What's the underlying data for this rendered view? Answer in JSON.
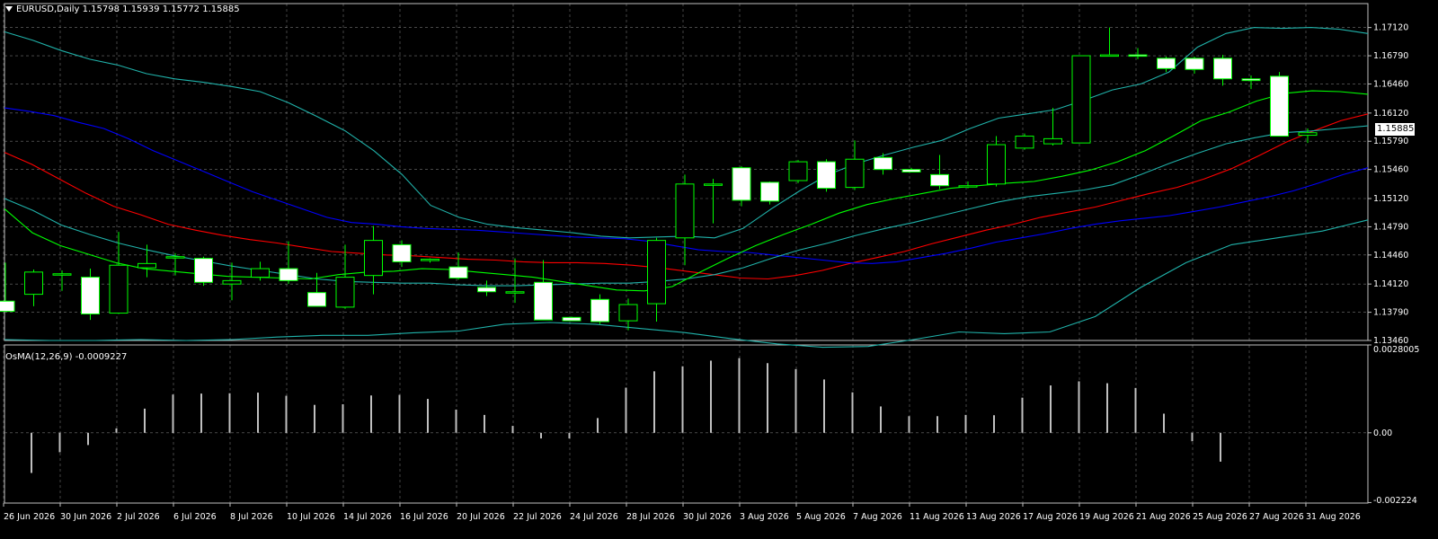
{
  "header": {
    "symbol_tf": "EURUSD,Daily",
    "ohlc": "1.15798 1.15939 1.15772 1.15885"
  },
  "osma_header": {
    "label": "OsMA(12,26,9) -0.0009227"
  },
  "current_price_label": "1.15885",
  "colors": {
    "background": "#000000",
    "grid": "#c0c0c0",
    "candle_body_up": "#000000",
    "candle_body_down": "#ffffff",
    "candle_outline": "#00ff00",
    "ma_red": "#ff0000",
    "ma_blue": "#0000ff",
    "bands": "#20b2aa",
    "ma_green": "#00ff00",
    "osma": "#c0c0c0"
  },
  "chart_data": [
    {
      "type": "candlestick",
      "title": "EURUSD,Daily",
      "ylim": [
        1.1346,
        1.174
      ],
      "y_ticks": [
        "1.17120",
        "1.16790",
        "1.16460",
        "1.16120",
        "1.15790",
        "1.15460",
        "1.15120",
        "1.14790",
        "1.14460",
        "1.14120",
        "1.13790",
        "1.13460"
      ],
      "x_labels": [
        "26 Jun 2026",
        "30 Jun 2026",
        "2 Jul 2026",
        "6 Jul 2026",
        "8 Jul 2026",
        "10 Jul 2026",
        "14 Jul 2026",
        "16 Jul 2026",
        "20 Jul 2026",
        "22 Jul 2026",
        "24 Jul 2026",
        "28 Jul 2026",
        "30 Jul 2026",
        "3 Aug 2026",
        "5 Aug 2026",
        "7 Aug 2026",
        "11 Aug 2026",
        "13 Aug 2026",
        "17 Aug 2026",
        "19 Aug 2026",
        "21 Aug 2026",
        "25 Aug 2026",
        "27 Aug 2026",
        "31 Aug 2026"
      ],
      "candles": [
        {
          "o": 1.1392,
          "h": 1.1437,
          "l": 1.138,
          "c": 1.138
        },
        {
          "o": 1.14,
          "h": 1.1429,
          "l": 1.1386,
          "c": 1.1426
        },
        {
          "o": 1.1424,
          "h": 1.1428,
          "l": 1.1404,
          "c": 1.1424
        },
        {
          "o": 1.142,
          "h": 1.143,
          "l": 1.137,
          "c": 1.1377
        },
        {
          "o": 1.1378,
          "h": 1.1473,
          "l": 1.1377,
          "c": 1.1434
        },
        {
          "o": 1.1431,
          "h": 1.1458,
          "l": 1.142,
          "c": 1.1436
        },
        {
          "o": 1.1444,
          "h": 1.1448,
          "l": 1.1422,
          "c": 1.1444
        },
        {
          "o": 1.1442,
          "h": 1.1444,
          "l": 1.141,
          "c": 1.1414
        },
        {
          "o": 1.1412,
          "h": 1.1437,
          "l": 1.1393,
          "c": 1.1416
        },
        {
          "o": 1.142,
          "h": 1.1438,
          "l": 1.1416,
          "c": 1.143
        },
        {
          "o": 1.143,
          "h": 1.1462,
          "l": 1.1412,
          "c": 1.1416
        },
        {
          "o": 1.1402,
          "h": 1.1425,
          "l": 1.139,
          "c": 1.1386
        },
        {
          "o": 1.1385,
          "h": 1.1458,
          "l": 1.1383,
          "c": 1.142
        },
        {
          "o": 1.1422,
          "h": 1.148,
          "l": 1.14,
          "c": 1.1463
        },
        {
          "o": 1.1458,
          "h": 1.1463,
          "l": 1.1432,
          "c": 1.1438
        },
        {
          "o": 1.1441,
          "h": 1.1442,
          "l": 1.1437,
          "c": 1.1441
        },
        {
          "o": 1.1432,
          "h": 1.1449,
          "l": 1.1417,
          "c": 1.1419
        },
        {
          "o": 1.1408,
          "h": 1.1416,
          "l": 1.1398,
          "c": 1.1403
        },
        {
          "o": 1.1403,
          "h": 1.1442,
          "l": 1.139,
          "c": 1.1403
        },
        {
          "o": 1.1414,
          "h": 1.144,
          "l": 1.137,
          "c": 1.137
        },
        {
          "o": 1.1373,
          "h": 1.1374,
          "l": 1.137,
          "c": 1.1369
        },
        {
          "o": 1.1394,
          "h": 1.14,
          "l": 1.1365,
          "c": 1.1368
        },
        {
          "o": 1.1369,
          "h": 1.1395,
          "l": 1.1358,
          "c": 1.1388
        },
        {
          "o": 1.1389,
          "h": 1.1466,
          "l": 1.1368,
          "c": 1.1463
        },
        {
          "o": 1.1466,
          "h": 1.154,
          "l": 1.1434,
          "c": 1.1529
        },
        {
          "o": 1.1528,
          "h": 1.1535,
          "l": 1.1483,
          "c": 1.1529
        },
        {
          "o": 1.1548,
          "h": 1.155,
          "l": 1.1503,
          "c": 1.151
        },
        {
          "o": 1.1531,
          "h": 1.1532,
          "l": 1.1505,
          "c": 1.1509
        },
        {
          "o": 1.1533,
          "h": 1.1557,
          "l": 1.153,
          "c": 1.1555
        },
        {
          "o": 1.1555,
          "h": 1.1558,
          "l": 1.152,
          "c": 1.1524
        },
        {
          "o": 1.1525,
          "h": 1.158,
          "l": 1.1522,
          "c": 1.1558
        },
        {
          "o": 1.156,
          "h": 1.1565,
          "l": 1.154,
          "c": 1.1546
        },
        {
          "o": 1.1546,
          "h": 1.1548,
          "l": 1.1543,
          "c": 1.1543
        },
        {
          "o": 1.154,
          "h": 1.1563,
          "l": 1.1523,
          "c": 1.1527
        },
        {
          "o": 1.1526,
          "h": 1.1532,
          "l": 1.1524,
          "c": 1.1527
        },
        {
          "o": 1.1529,
          "h": 1.1585,
          "l": 1.1526,
          "c": 1.1575
        },
        {
          "o": 1.1571,
          "h": 1.1588,
          "l": 1.1569,
          "c": 1.1585
        },
        {
          "o": 1.1576,
          "h": 1.1618,
          "l": 1.1574,
          "c": 1.1582
        },
        {
          "o": 1.1577,
          "h": 1.1679,
          "l": 1.1577,
          "c": 1.1679
        },
        {
          "o": 1.168,
          "h": 1.1712,
          "l": 1.1678,
          "c": 1.168
        },
        {
          "o": 1.168,
          "h": 1.1688,
          "l": 1.1675,
          "c": 1.1679
        },
        {
          "o": 1.1676,
          "h": 1.1678,
          "l": 1.166,
          "c": 1.1664
        },
        {
          "o": 1.1676,
          "h": 1.1678,
          "l": 1.1658,
          "c": 1.1663
        },
        {
          "o": 1.1676,
          "h": 1.168,
          "l": 1.1644,
          "c": 1.1652
        },
        {
          "o": 1.1652,
          "h": 1.1656,
          "l": 1.164,
          "c": 1.165
        },
        {
          "o": 1.1655,
          "h": 1.166,
          "l": 1.1585,
          "c": 1.1585
        },
        {
          "o": 1.1586,
          "h": 1.1594,
          "l": 1.1577,
          "c": 1.1589
        }
      ],
      "overlays": [
        {
          "color_key": "ma_red",
          "values": [
            1.1566,
            1.1552,
            1.1535,
            1.1518,
            1.1503,
            1.1493,
            1.1482,
            1.1475,
            1.1469,
            1.1464,
            1.146,
            1.1455,
            1.145,
            1.1448,
            1.1446,
            1.1445,
            1.1443,
            1.1441,
            1.144,
            1.1438,
            1.1437,
            1.1437,
            1.1436,
            1.1434,
            1.1431,
            1.1427,
            1.1423,
            1.1419,
            1.1418,
            1.1422,
            1.1428,
            1.1436,
            1.1443,
            1.145,
            1.1459,
            1.1467,
            1.1475,
            1.1482,
            1.149,
            1.1496,
            1.1502,
            1.151,
            1.1518,
            1.1525,
            1.1535,
            1.1547,
            1.1562,
            1.1578,
            1.1591,
            1.1603,
            1.1611
          ]
        },
        {
          "color_key": "ma_blue",
          "values": [
            1.1618,
            1.1614,
            1.1609,
            1.1601,
            1.1594,
            1.1582,
            1.1568,
            1.1556,
            1.1544,
            1.1532,
            1.152,
            1.151,
            1.15,
            1.149,
            1.1484,
            1.1482,
            1.1479,
            1.1477,
            1.1476,
            1.1475,
            1.1473,
            1.1471,
            1.1469,
            1.1467,
            1.1466,
            1.1465,
            1.1462,
            1.1457,
            1.1452,
            1.145,
            1.1449,
            1.1446,
            1.1443,
            1.144,
            1.1437,
            1.1436,
            1.1438,
            1.1443,
            1.1448,
            1.1454,
            1.1461,
            1.1466,
            1.1471,
            1.1477,
            1.1482,
            1.1486,
            1.1489,
            1.1492,
            1.1497,
            1.1502,
            1.1508,
            1.1514,
            1.1521,
            1.153,
            1.154,
            1.1548
          ]
        },
        {
          "color_key": "bands",
          "values": [
            1.1707,
            1.1697,
            1.1685,
            1.1675,
            1.1668,
            1.1658,
            1.1652,
            1.1648,
            1.1643,
            1.1637,
            1.1624,
            1.1608,
            1.1591,
            1.1568,
            1.154,
            1.1504,
            1.149,
            1.1482,
            1.1478,
            1.1475,
            1.1472,
            1.1468,
            1.1466,
            1.1467,
            1.1468,
            1.1466,
            1.1477,
            1.15,
            1.1521,
            1.154,
            1.1553,
            1.1563,
            1.1572,
            1.158,
            1.1594,
            1.1606,
            1.1611,
            1.1616,
            1.1627,
            1.1639,
            1.1646,
            1.166,
            1.1689,
            1.1705,
            1.1712,
            1.1711,
            1.1712,
            1.171,
            1.1705
          ]
        },
        {
          "color_key": "bands",
          "values": [
            1.1512,
            1.1498,
            1.1481,
            1.147,
            1.146,
            1.1452,
            1.1445,
            1.1439,
            1.1433,
            1.1428,
            1.1423,
            1.1418,
            1.1415,
            1.1414,
            1.1413,
            1.1413,
            1.1411,
            1.141,
            1.141,
            1.1411,
            1.1412,
            1.1413,
            1.1413,
            1.1415,
            1.1418,
            1.1423,
            1.1431,
            1.1442,
            1.1452,
            1.146,
            1.1469,
            1.1477,
            1.1484,
            1.1492,
            1.15,
            1.1508,
            1.1514,
            1.1518,
            1.1522,
            1.1528,
            1.154,
            1.1553,
            1.1565,
            1.1576,
            1.1583,
            1.1589,
            1.1591,
            1.1594,
            1.1597
          ]
        },
        {
          "color_key": "bands",
          "values": [
            1.1347,
            1.1346,
            1.1346,
            1.1347,
            1.1346,
            1.1347,
            1.135,
            1.1352,
            1.1352,
            1.1355,
            1.1357,
            1.1365,
            1.1367,
            1.1365,
            1.136,
            1.1355,
            1.1348,
            1.1342,
            1.1338,
            1.1339,
            1.1347,
            1.1356,
            1.1354,
            1.1356,
            1.1374,
            1.1408,
            1.1437,
            1.1458,
            1.1466,
            1.1474,
            1.1487
          ]
        },
        {
          "color_key": "ma_green",
          "values": [
            1.15,
            1.1472,
            1.1457,
            1.1447,
            1.1437,
            1.143,
            1.1427,
            1.1424,
            1.1421,
            1.142,
            1.1419,
            1.1418,
            1.1423,
            1.1426,
            1.1427,
            1.143,
            1.1429,
            1.1426,
            1.1423,
            1.142,
            1.1415,
            1.141,
            1.1405,
            1.1404,
            1.1409,
            1.1426,
            1.1442,
            1.1457,
            1.147,
            1.1482,
            1.1495,
            1.1505,
            1.1512,
            1.1518,
            1.1524,
            1.1527,
            1.153,
            1.1532,
            1.1538,
            1.1545,
            1.1555,
            1.1568,
            1.1585,
            1.1603,
            1.1613,
            1.1626,
            1.1635,
            1.1638,
            1.1637,
            1.1634
          ]
        }
      ]
    },
    {
      "type": "bar",
      "title": "OsMA(12,26,9) -0.0009227",
      "ylim": [
        -0.00224,
        0.0028
      ],
      "y_ticks": [
        "0.0028005",
        "0.00",
        "-0.002224"
      ],
      "values": [
        -0.00128,
        -0.00062,
        -0.00039,
        0.00014,
        0.00077,
        0.00122,
        0.00125,
        0.00126,
        0.00128,
        0.00118,
        0.00089,
        0.00091,
        0.00119,
        0.00121,
        0.00108,
        0.00074,
        0.00057,
        0.00022,
        -0.00018,
        -0.00018,
        0.00047,
        0.00144,
        0.00196,
        0.00212,
        0.0023,
        0.00238,
        0.00222,
        0.00203,
        0.0017,
        0.00129,
        0.00084,
        0.00053,
        0.00053,
        0.00057,
        0.00056,
        0.00112,
        0.00151,
        0.00164,
        0.00158,
        0.00143,
        0.00061,
        -0.00027,
        -0.00092
      ]
    }
  ]
}
